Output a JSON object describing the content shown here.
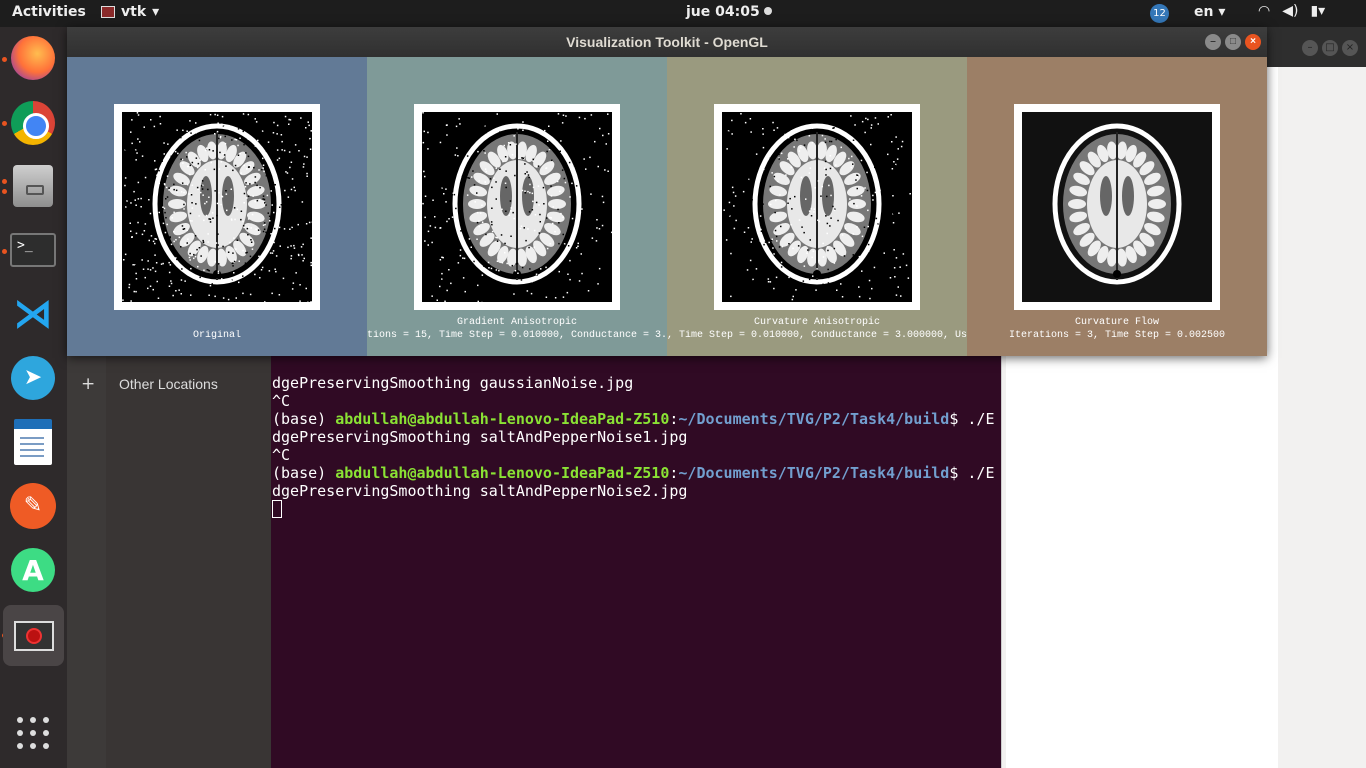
{
  "topbar": {
    "activities": "Activities",
    "app_name": "vtk",
    "clock": "jue 04:05",
    "notifications_badge": "12",
    "language": "en"
  },
  "dock": {
    "items": [
      "firefox-icon",
      "chrome-icon",
      "files-icon",
      "terminal-icon",
      "vscode-icon",
      "telegram-icon",
      "libreoffice-writer-icon",
      "postman-icon",
      "android-studio-icon",
      "vtk-app-icon"
    ],
    "terminal_glyph": ">_"
  },
  "nautilus": {
    "other_locations": "Other Locations",
    "plus": "+"
  },
  "terminal": {
    "line1": "dgePreservingSmoothing gaussianNoise.jpg",
    "line2": "^C",
    "prompt_prefix": "(base) ",
    "user_host": "abdullah@abdullah-Lenovo-IdeaPad-Z510",
    "colon": ":",
    "path": "~/Documents/TVG/P2/Task4/build",
    "prompt_tail": "$ ./E",
    "line4": "dgePreservingSmoothing saltAndPepperNoise1.jpg",
    "line5": "^C",
    "line7": "dgePreservingSmoothing saltAndPepperNoise2.jpg"
  },
  "vtk_window": {
    "title": "Visualization Toolkit - OpenGL",
    "panels": [
      {
        "title": "",
        "caption": "Original",
        "bg": "#627a96"
      },
      {
        "title": "Gradient Anisotropic",
        "caption": "tions = 15, Time Step = 0.010000, Conductance = 3.0",
        "bg": "#7f9a98"
      },
      {
        "title": "Curvature Anisotropic",
        "caption": ", Time Step = 0.010000, Conductance = 3.000000, Us",
        "bg": "#9a9a7f"
      },
      {
        "title": "Curvature Flow",
        "caption": "Iterations = 3, Time Step = 0.002500",
        "bg": "#9c7f66"
      }
    ]
  },
  "colors": {
    "ubuntu_orange": "#e95420",
    "terminal_bg": "#300a24",
    "prompt_user": "#8ae234",
    "prompt_path": "#729fcf"
  }
}
